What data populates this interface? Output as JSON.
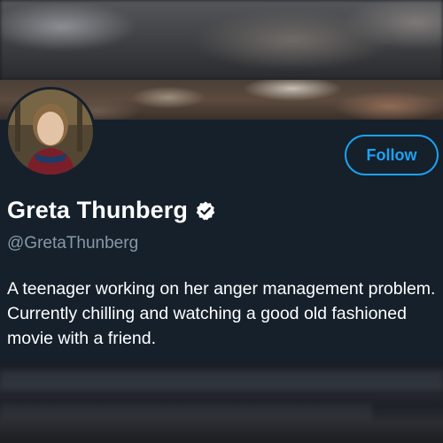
{
  "profile": {
    "display_name": "Greta Thunberg",
    "handle": "@GretaThunberg",
    "verified": true,
    "bio": "A teenager working on her anger management problem. Currently chilling and watching a good old fashioned movie with a friend.",
    "follow_label": "Follow"
  },
  "colors": {
    "card_bg": "#15202b",
    "accent": "#1da1f2",
    "secondary_text": "#8899a6",
    "primary_text": "#ffffff"
  },
  "icons": {
    "verified": "verified-badge-icon",
    "avatar": "profile-photo"
  }
}
